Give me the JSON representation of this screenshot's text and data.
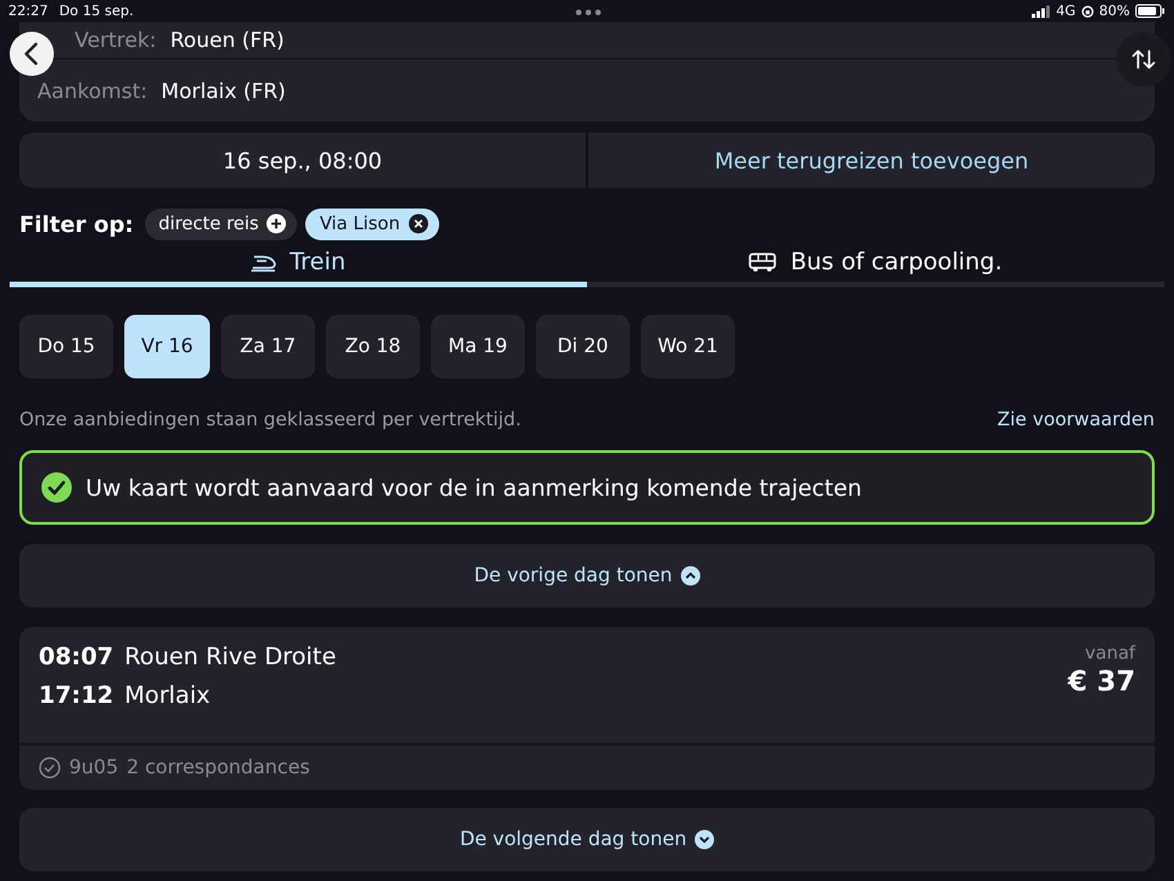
{
  "status_bar": {
    "time": "22:27",
    "date": "Do 15 sep.",
    "network": "4G",
    "battery": "80%"
  },
  "route": {
    "departure": {
      "label": "Vertrek:",
      "value": "Rouen (FR)"
    },
    "arrival": {
      "label": "Aankomst:",
      "value": "Morlaix (FR)"
    }
  },
  "trip_bar": {
    "date": "16 sep., 08:00",
    "add_return": "Meer terugreizen toevoegen"
  },
  "filter": {
    "label": "Filter op:",
    "chips": [
      {
        "label": "directe reis",
        "selected": false
      },
      {
        "label": "Via Lison",
        "selected": true
      }
    ]
  },
  "tabs": [
    {
      "kind": "train",
      "label": "Trein",
      "selected": true
    },
    {
      "kind": "bus",
      "label": "Bus of carpooling.",
      "selected": false
    }
  ],
  "days": [
    {
      "label": "Do 15",
      "selected": false
    },
    {
      "label": "Vr 16",
      "selected": true
    },
    {
      "label": "Za 17",
      "selected": false
    },
    {
      "label": "Zo 18",
      "selected": false
    },
    {
      "label": "Ma 19",
      "selected": false
    },
    {
      "label": "Di 20",
      "selected": false
    },
    {
      "label": "Wo 21",
      "selected": false
    }
  ],
  "note": "Onze aanbiedingen staan geklasseerd per vertrektijd.",
  "conditions_link": "Zie voorwaarden",
  "banner": "Uw kaart wordt aanvaard voor de in aanmerking komende trajecten",
  "previous_day": "De vorige dag tonen",
  "journeys": [
    {
      "depart_time": "08:07",
      "depart_station": "Rouen Rive Droite",
      "arrive_time": "17:12",
      "arrive_station": "Morlaix",
      "price_prefix": "vanaf",
      "price": "€ 37",
      "duration": "9u05",
      "connections": "2 correspondances"
    }
  ],
  "next_day": "De volgende dag tonen"
}
